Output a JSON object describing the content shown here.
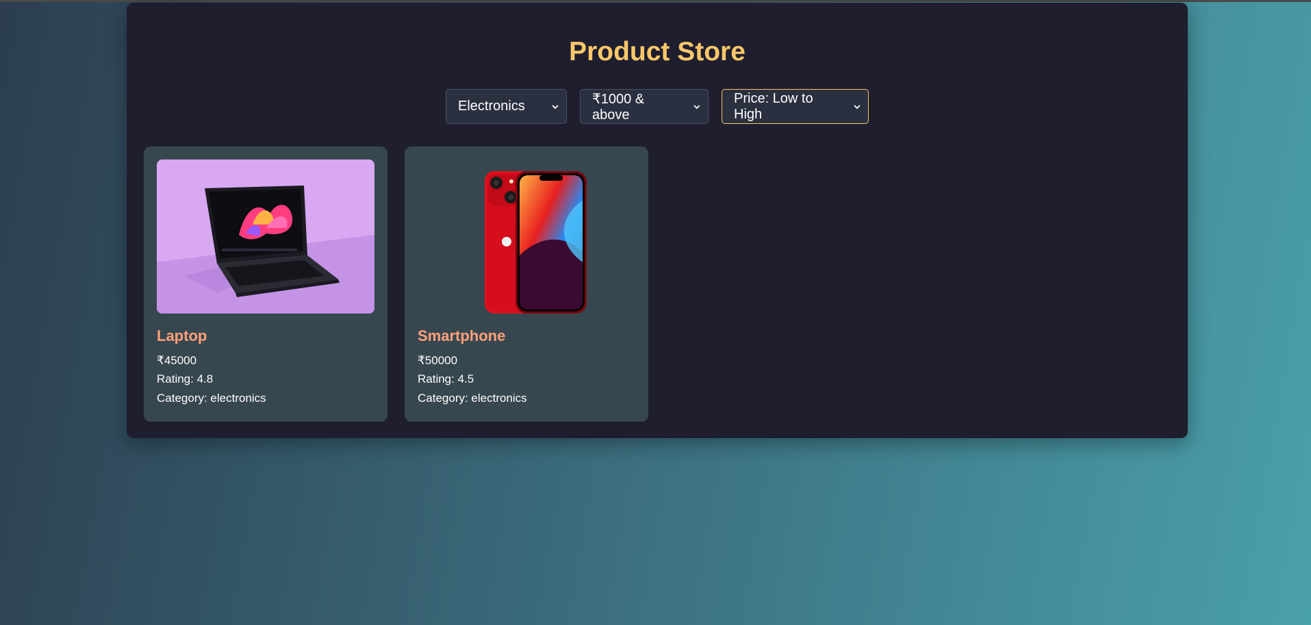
{
  "page": {
    "title": "Product Store"
  },
  "filters": {
    "category": {
      "selected": "Electronics"
    },
    "price": {
      "selected": "₹1000 & above"
    },
    "sort": {
      "selected": "Price: Low to High"
    }
  },
  "products": [
    {
      "name": "Laptop",
      "price": "₹45000",
      "rating": "Rating: 4.8",
      "category": "Category: electronics",
      "image_icon": "laptop-image"
    },
    {
      "name": "Smartphone",
      "price": "₹50000",
      "rating": "Rating: 4.5",
      "category": "Category: electronics",
      "image_icon": "smartphone-image"
    }
  ],
  "colors": {
    "title": "#f9c76a",
    "product_name": "#ffa07a",
    "card_bg": "#37474f",
    "container_bg": "#1e1e2e"
  }
}
